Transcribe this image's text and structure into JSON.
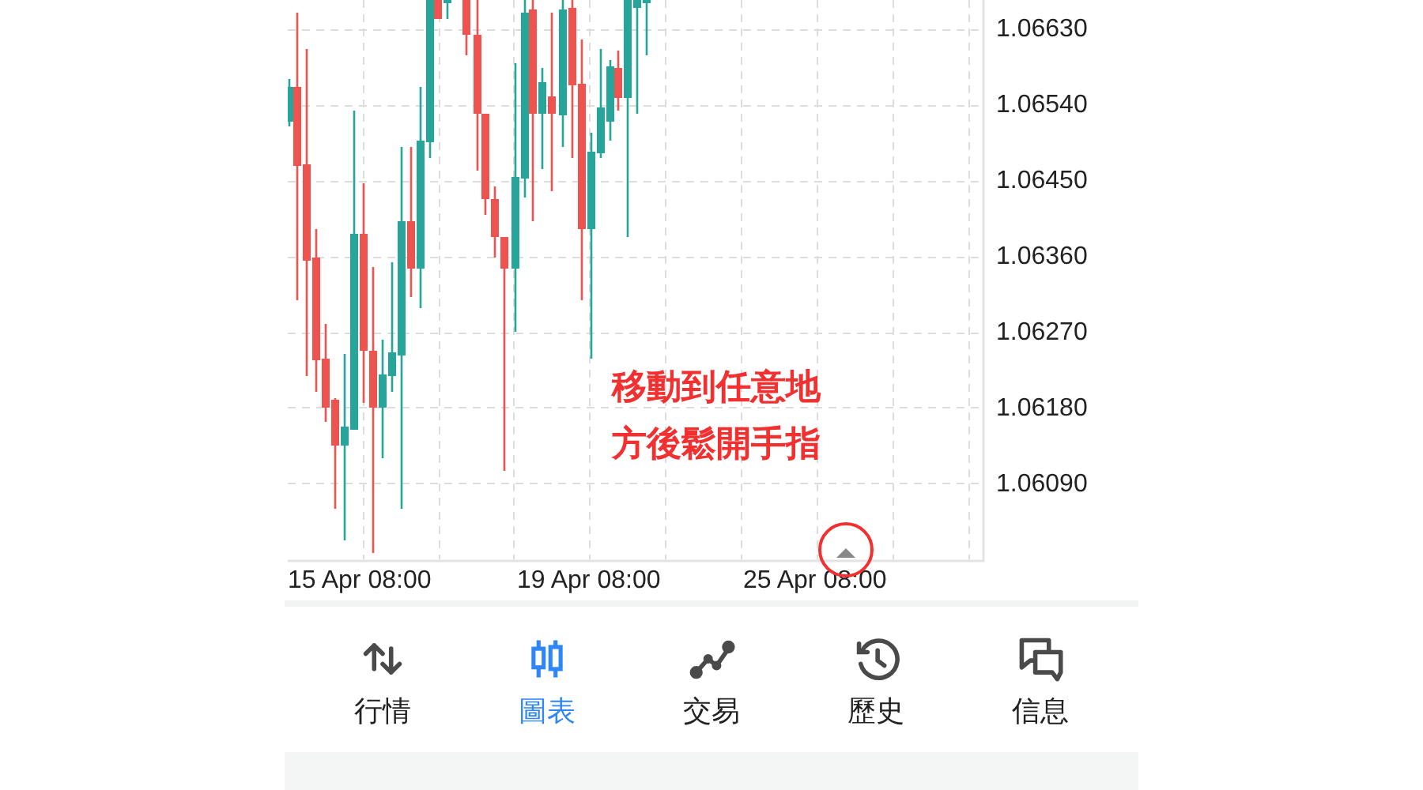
{
  "chart": {
    "price_axis": [
      "1.06630",
      "1.06540",
      "1.06450",
      "1.06360",
      "1.06270",
      "1.06180",
      "1.06090"
    ],
    "time_axis": [
      "15 Apr 08:00",
      "19 Apr 08:00",
      "25 Apr 08:00"
    ],
    "hint_lines": [
      "移動到任意地",
      "方後鬆開手指"
    ]
  },
  "nav": [
    {
      "label": "行情",
      "selected": false
    },
    {
      "label": "圖表",
      "selected": true
    },
    {
      "label": "交易",
      "selected": false
    },
    {
      "label": "歷史",
      "selected": false
    },
    {
      "label": "信息",
      "selected": false
    }
  ]
}
